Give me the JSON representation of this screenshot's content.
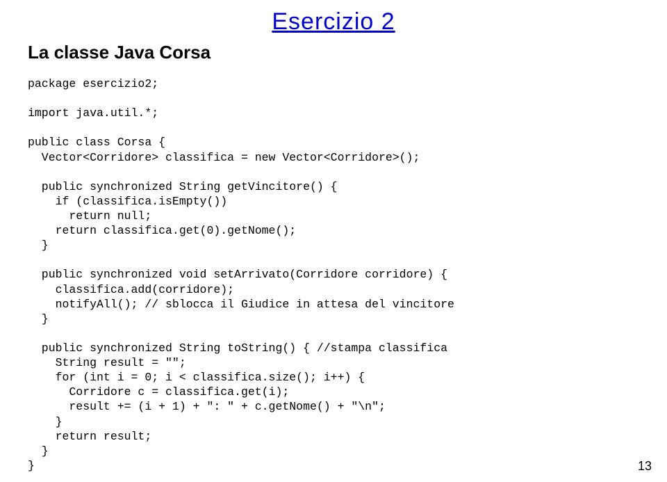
{
  "slide": {
    "title": "Esercizio 2",
    "subtitle": "La classe Java Corsa",
    "page_number": "13"
  },
  "code": {
    "line1": "package esercizio2;",
    "line2": "",
    "line3": "import java.util.*;",
    "line4": "",
    "line5": "public class Corsa {",
    "line6": "  Vector<Corridore> classifica = new Vector<Corridore>();",
    "line7": "",
    "line8": "  public synchronized String getVincitore() {",
    "line9": "    if (classifica.isEmpty())",
    "line10": "      return null;",
    "line11": "    return classifica.get(0).getNome();",
    "line12": "  }",
    "line13": "",
    "line14": "  public synchronized void setArrivato(Corridore corridore) {",
    "line15": "    classifica.add(corridore);",
    "line16": "    notifyAll(); // sblocca il Giudice in attesa del vincitore",
    "line17": "  }",
    "line18": "",
    "line19": "  public synchronized String toString() { //stampa classifica",
    "line20": "    String result = \"\";",
    "line21": "    for (int i = 0; i < classifica.size(); i++) {",
    "line22": "      Corridore c = classifica.get(i);",
    "line23": "      result += (i + 1) + \": \" + c.getNome() + \"\\n\";",
    "line24": "    }",
    "line25": "    return result;",
    "line26": "  }",
    "line27": "}"
  }
}
